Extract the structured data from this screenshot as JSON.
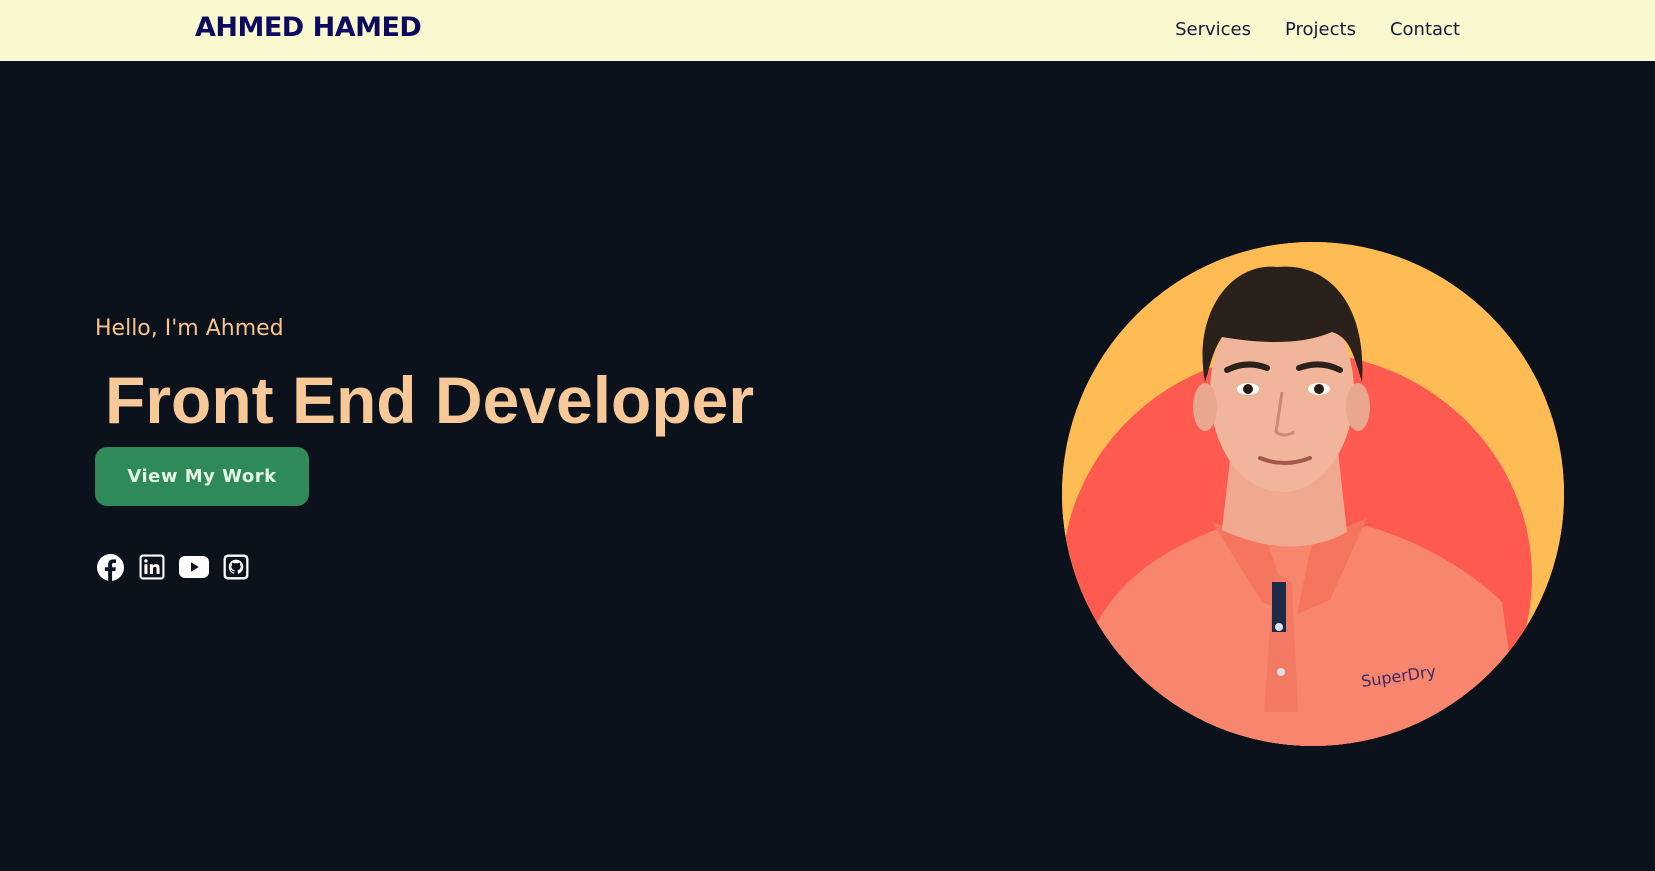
{
  "header": {
    "brand": "AHMED HAMED",
    "nav": [
      {
        "label": "Services"
      },
      {
        "label": "Projects"
      },
      {
        "label": "Contact"
      }
    ]
  },
  "hero": {
    "greeting": "Hello, I'm Ahmed",
    "title": "Front End Developer",
    "cta_label": "View My Work",
    "socials": [
      "facebook-icon",
      "linkedin-icon",
      "youtube-icon",
      "github-icon"
    ],
    "portrait": "portrait-photo"
  },
  "colors": {
    "nav_bg": "#f9f8ce",
    "page_bg": "#0b121c",
    "accent": "#f7c999",
    "cta_bg": "#2e8a58",
    "circle_outer": "#ffbc54",
    "circle_inner": "#ff5a4f"
  }
}
